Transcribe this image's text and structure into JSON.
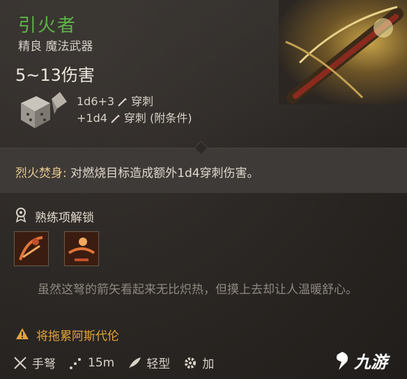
{
  "item": {
    "name": "引火者",
    "type": "精良 魔法武器",
    "damage": "5~13伤害"
  },
  "rolls": [
    {
      "dice": "1d6+3",
      "damage_type": "穿刺"
    },
    {
      "dice": "+1d4",
      "damage_type": "穿刺 (附条件)"
    }
  ],
  "passive": {
    "name": "烈火焚身:",
    "description": " 对燃烧目标造成额外1d4穿刺伤害。"
  },
  "proficiency": {
    "title": "熟练项解锁",
    "actions": [
      "action-1",
      "action-2"
    ]
  },
  "flavor_text": "虽然这弩的箭矢看起来无比炽热，但摸上去却让人温暖舒心。",
  "warning": "将拖累阿斯代伦",
  "footer": {
    "weapon_class": "手弩",
    "range": "15m",
    "weight_class": "轻型",
    "extra": "加"
  },
  "watermark": "九游",
  "colors": {
    "name": "#5fb34a",
    "passive_name": "#e6c98e",
    "warning": "#e1a33c",
    "flavor": "#8e8780"
  }
}
